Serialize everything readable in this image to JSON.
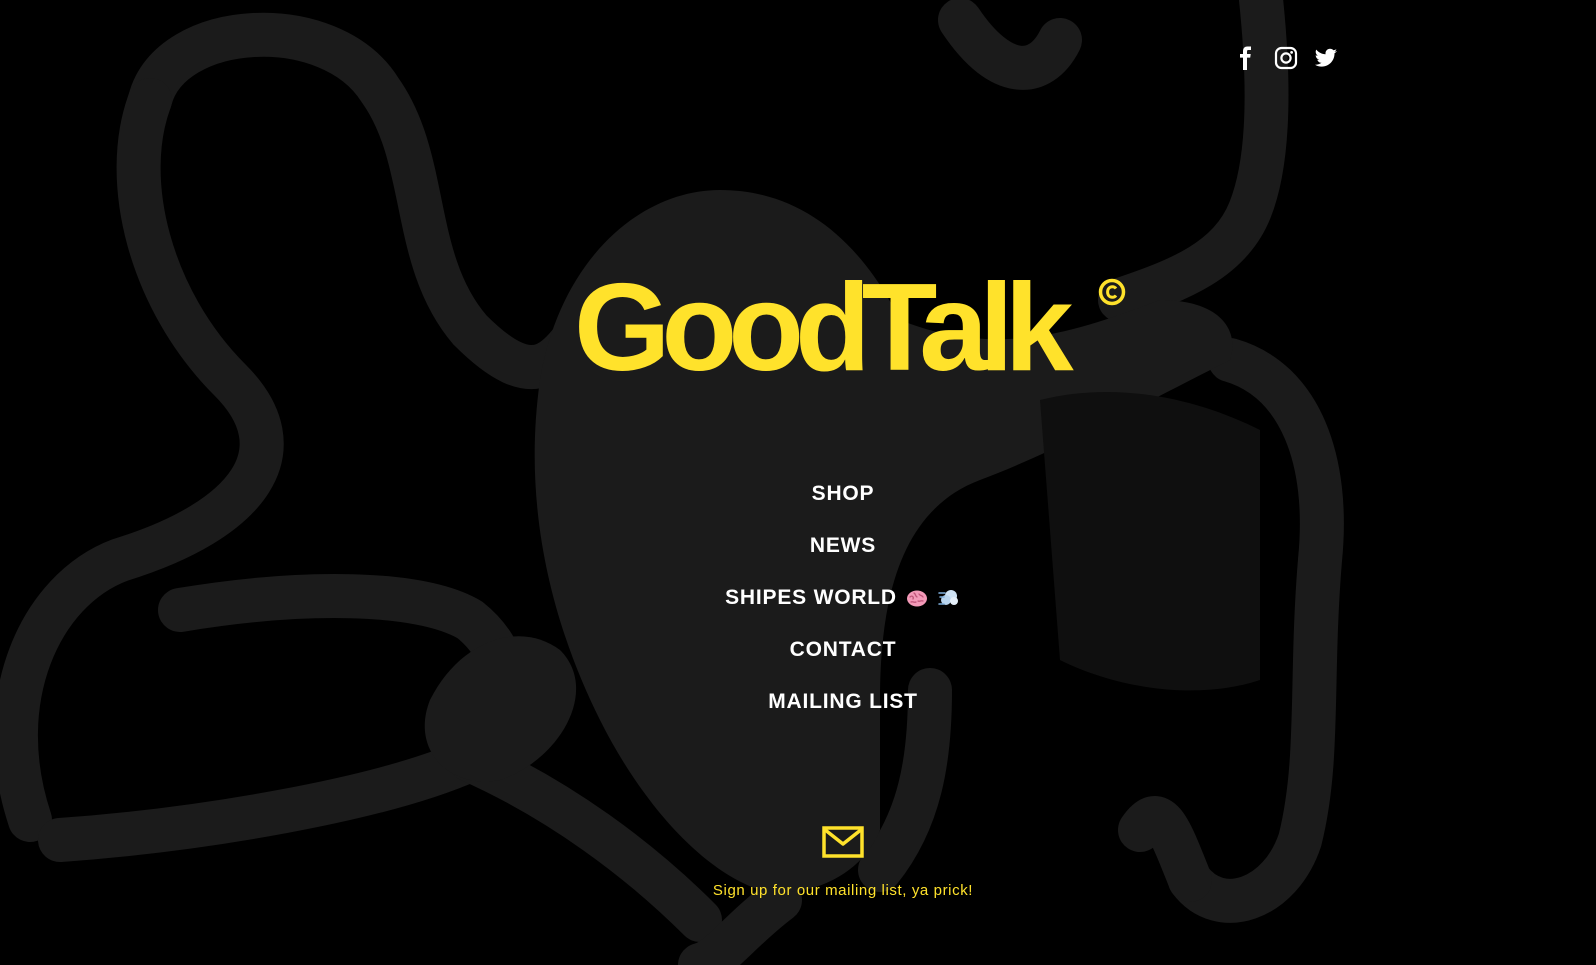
{
  "colors": {
    "background": "#000000",
    "art": "#1b1b1b",
    "brand_yellow": "#FFE22B",
    "nav_text": "#ffffff"
  },
  "social": [
    {
      "icon": "facebook-icon"
    },
    {
      "icon": "instagram-icon"
    },
    {
      "icon": "twitter-icon"
    }
  ],
  "logo": {
    "text": "GoodTalk",
    "mark": "©"
  },
  "nav": {
    "items": [
      {
        "label": "SHOP"
      },
      {
        "label": "NEWS"
      },
      {
        "label": "SHIPES WORLD",
        "emoji": [
          "brain-icon",
          "dash-icon"
        ]
      },
      {
        "label": "CONTACT"
      },
      {
        "label": "MAILING LIST"
      }
    ]
  },
  "signup": {
    "icon": "envelope-icon",
    "text": "Sign up for our mailing list, ya prick!"
  }
}
